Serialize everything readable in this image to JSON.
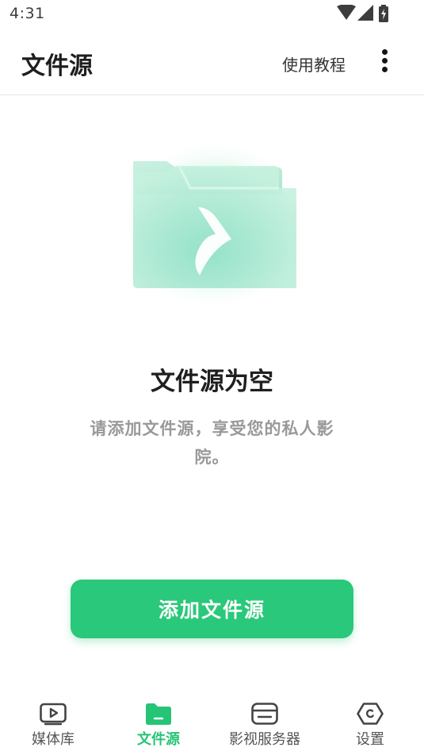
{
  "status_bar": {
    "time": "4:31"
  },
  "header": {
    "title": "文件源",
    "tutorial_label": "使用教程"
  },
  "empty_state": {
    "title": "文件源为空",
    "subtitle": "请添加文件源，享受您的私人影院。"
  },
  "add_button_label": "添加文件源",
  "bottom_nav": [
    {
      "label": "媒体库",
      "icon": "media-library-icon",
      "active": false
    },
    {
      "label": "文件源",
      "icon": "folder-icon",
      "active": true
    },
    {
      "label": "影视服务器",
      "icon": "server-icon",
      "active": false
    },
    {
      "label": "设置",
      "icon": "settings-icon",
      "active": false
    }
  ],
  "colors": {
    "accent": "#2ac87a",
    "nav_active": "#26c477",
    "nav_inactive": "#555555"
  }
}
